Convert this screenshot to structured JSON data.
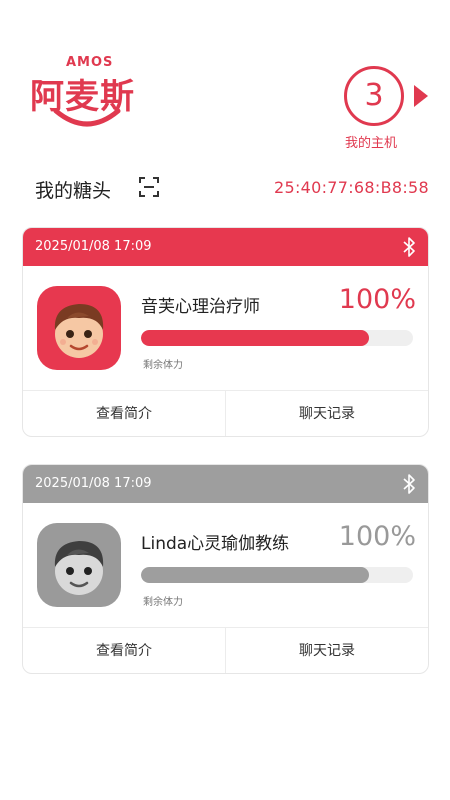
{
  "logo": {
    "sub": "AMOS",
    "main": "阿麦斯"
  },
  "host": {
    "count": "3",
    "label": "我的主机"
  },
  "section": {
    "title": "我的糖头",
    "mac": "25:40:77:68:B8:58"
  },
  "colors": {
    "accent": "#e7384f",
    "inactive": "#9e9e9e"
  },
  "cards": [
    {
      "time": "2025/01/08 17:09",
      "name": "音芙心理治疗师",
      "percent_text": "100%",
      "stamina_fraction": 0.84,
      "stamina_label": "剩余体力",
      "intro_label": "查看简介",
      "chat_label": "聊天记录",
      "status": "active"
    },
    {
      "time": "2025/01/08 17:09",
      "name": "Linda心灵瑜伽教练",
      "percent_text": "100%",
      "stamina_fraction": 0.84,
      "stamina_label": "剩余体力",
      "intro_label": "查看简介",
      "chat_label": "聊天记录",
      "status": "inactive"
    }
  ]
}
